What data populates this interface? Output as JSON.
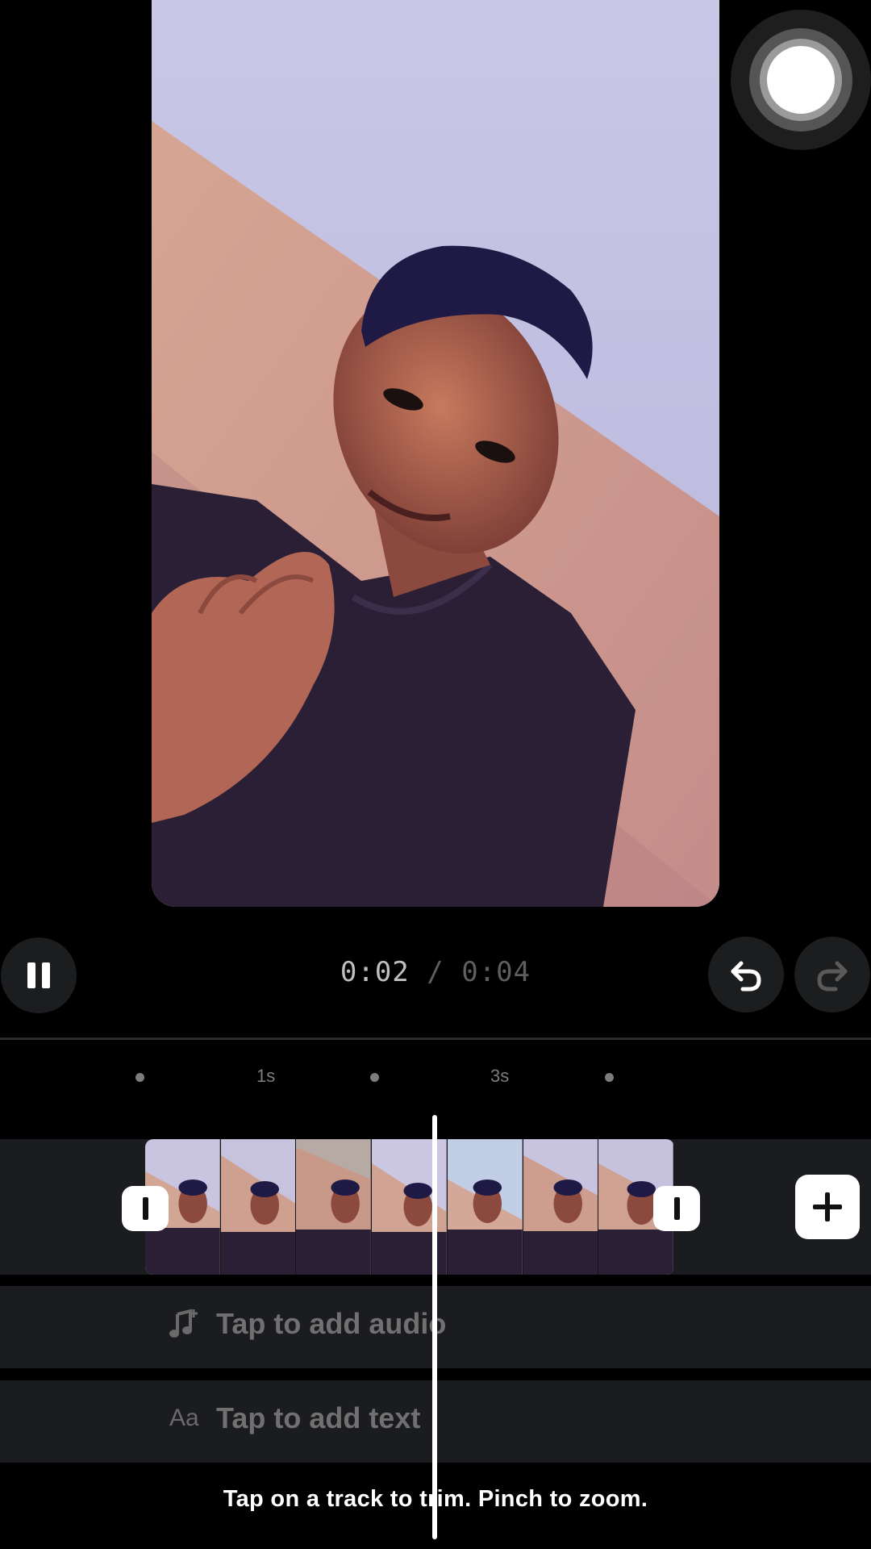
{
  "playback": {
    "current_time": "0:02",
    "separator": "/",
    "total_time": "0:04"
  },
  "timeline": {
    "ruler_labels": [
      "1s",
      "3s"
    ],
    "audio_track_label": "Tap to add audio",
    "text_track_label": "Tap to add text",
    "text_icon_glyph": "Aa"
  },
  "hint": "Tap on a track to trim. Pinch to zoom.",
  "icons": {
    "pause": "pause-icon",
    "undo": "undo-icon",
    "redo": "redo-icon",
    "add": "plus-icon",
    "music": "music-note-plus-icon",
    "assistive": "assistive-touch-icon"
  },
  "colors": {
    "background": "#000000",
    "track_bg": "#1b1c1f",
    "button_bg": "#1c1d1f",
    "muted_text": "#707070"
  }
}
